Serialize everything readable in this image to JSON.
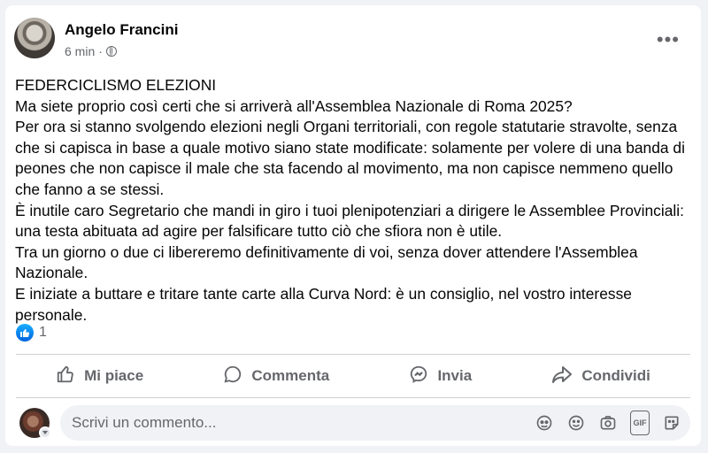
{
  "post": {
    "author": "Angelo Francini",
    "time": "6 min",
    "separator": "·",
    "paragraphs": [
      "FEDERCICLISMO ELEZIONI",
      "Ma siete proprio così certi che si arriverà all'Assemblea Nazionale di Roma 2025?",
      "Per ora si stanno svolgendo elezioni negli Organi territoriali, con regole statutarie stravolte, senza che si capisca in base a quale motivo siano state modificate: solamente per volere di una banda di peones che non capisce il male che sta facendo al movimento, ma non capisce nemmeno quello che fanno a se stessi.",
      "È inutile caro Segretario che mandi in giro i tuoi plenipotenziari a dirigere le Assemblee Provinciali: una testa abituata ad agire per falsificare tutto ciò che sfiora non è utile.",
      "Tra un giorno o due ci libereremo definitivamente di voi, senza dover attendere l'Assemblea Nazionale.",
      "E iniziate a buttare e tritare tante carte alla Curva Nord: è un consiglio, nel vostro interesse personale."
    ],
    "more_icon": "•••"
  },
  "reactions": {
    "count": "1",
    "icon": "like-reaction-icon"
  },
  "actions": {
    "like": "Mi piace",
    "comment": "Commenta",
    "send": "Invia",
    "share": "Condividi"
  },
  "comment_box": {
    "placeholder": "Scrivi un commento...",
    "gif_label": "GIF"
  },
  "colors": {
    "background": "#f0f2f5",
    "card": "#ffffff",
    "text": "#050505",
    "secondary": "#65676b",
    "like_blue": "#0866ff"
  }
}
